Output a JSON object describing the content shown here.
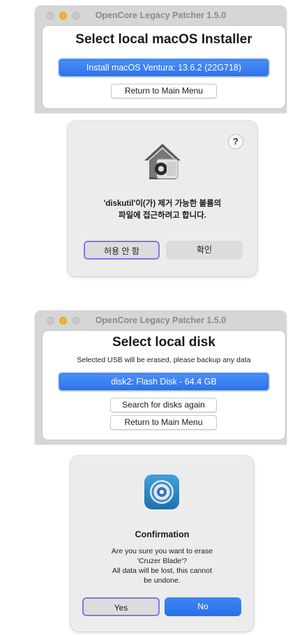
{
  "window1": {
    "title": "OpenCore Legacy Patcher 1.5.0",
    "heading": "Select local macOS Installer",
    "installer_option": "Install macOS Ventura: 13.6.2 (22G718)",
    "return_button": "Return to Main Menu"
  },
  "dialog1": {
    "message_line1": "'diskutil'이(가) 제거 가능한 볼륨의",
    "message_line2": "파일에 접근하려고 합니다.",
    "deny_button": "허용 안 함",
    "ok_button": "확인",
    "help_label": "?"
  },
  "window2": {
    "title": "OpenCore Legacy Patcher 1.5.0",
    "heading": "Select local disk",
    "subtitle": "Selected USB will be erased, please backup any data",
    "disk_option": "disk2: Flash Disk - 64.4 GB",
    "search_button": "Search for disks again",
    "return_button": "Return to Main Menu"
  },
  "dialog2": {
    "title": "Confirmation",
    "message_line1": "Are you sure you want to erase",
    "message_line2": "'Cruzer Blade'?",
    "message_line3": "All data will be lost, this cannot",
    "message_line4": "be undone.",
    "yes_button": "Yes",
    "no_button": "No"
  },
  "colors": {
    "accent_blue": "#2f74ee",
    "window_bg": "#d6d6d6",
    "dialog_bg": "#ececec",
    "minimize_yellow": "#f5b324"
  }
}
